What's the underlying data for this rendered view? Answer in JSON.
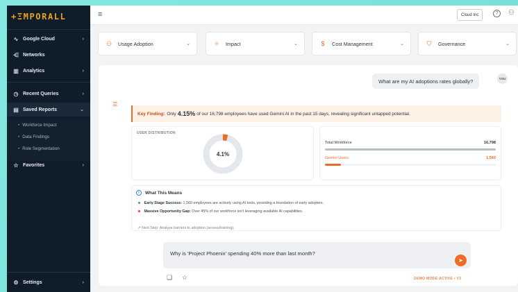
{
  "app": {
    "logo": "+ΞMPORALL"
  },
  "sidebar": {
    "items": [
      {
        "label": "Google Cloud",
        "icon": "pulse-icon",
        "glyph": "∿",
        "chevron": "›"
      },
      {
        "label": "Networks",
        "icon": "network-icon",
        "glyph": "⋲",
        "chevron": ""
      },
      {
        "label": "Analytics",
        "icon": "bar-chart-icon",
        "glyph": "▥",
        "chevron": "›"
      },
      {
        "label": "Recent Queries",
        "icon": "clock-icon",
        "glyph": "◷",
        "chevron": "›"
      },
      {
        "label": "Saved Reports",
        "icon": "document-icon",
        "glyph": "▤",
        "chevron": "⌄"
      },
      {
        "label": "Favorites",
        "icon": "star-icon",
        "glyph": "☆",
        "chevron": "›"
      }
    ],
    "sub_items": [
      "Workforce Impact",
      "Data Findings",
      "Role Segmentation"
    ],
    "settings": {
      "label": "Settings",
      "glyph": "⚙",
      "chevron": "›"
    }
  },
  "topbar": {
    "menu_glyph": "≡",
    "org_label": "Cloud Inc",
    "help_glyph": "?",
    "user_glyph": "⚇"
  },
  "filters": [
    {
      "label": "Usage Adoption",
      "icon": "users-icon",
      "glyph": "⚇"
    },
    {
      "label": "Impact",
      "icon": "impact-icon",
      "glyph": "✧"
    },
    {
      "label": "Cost Management",
      "icon": "dollar-icon",
      "glyph": "$"
    },
    {
      "label": "Governance",
      "icon": "shield-icon",
      "glyph": "⛉"
    }
  ],
  "chat": {
    "question": "What are my AI adoptions rates globally?",
    "you_label": "YOU",
    "finding": {
      "label": "Key Finding:",
      "prefix": "Only",
      "percent": "4.15%",
      "text": "of our 16,798 employees have used Gemini AI in the past 15 days, revealing significant untapped potential."
    },
    "distribution": {
      "label": "USER DISTRIBUTION",
      "center_label": "4.1%",
      "fraction": 0.0415
    },
    "stats": {
      "total_label": "Total Workforce",
      "total_value": "16,798",
      "gemini_label": "Gemini Users",
      "gemini_value": "1,560",
      "gemini_fraction": 0.093
    },
    "meaning": {
      "title": "What This Means",
      "points": [
        {
          "bold": "Early Stage Success:",
          "text": "1,560 employees are actively using AI tools, providing a foundation of early adopters.",
          "color": "#3aa55c"
        },
        {
          "bold": "Massive Opportunity Gap:",
          "text": "Over 45% of our workforce isn't leveraging available AI capabilities.",
          "color": "#e0452b"
        }
      ],
      "next_step": "Next Step: Analyze barriers to adoption (access/training)."
    }
  },
  "input": {
    "text": "Why is 'Project Phoenix' spending 40% more than last month?",
    "send_glyph": "➤"
  },
  "footer": {
    "demo_label": "DEMO MODE ACTIVE • V3"
  },
  "colors": {
    "accent": "#ea6a2c",
    "sidebar": "#0f1c2a"
  }
}
